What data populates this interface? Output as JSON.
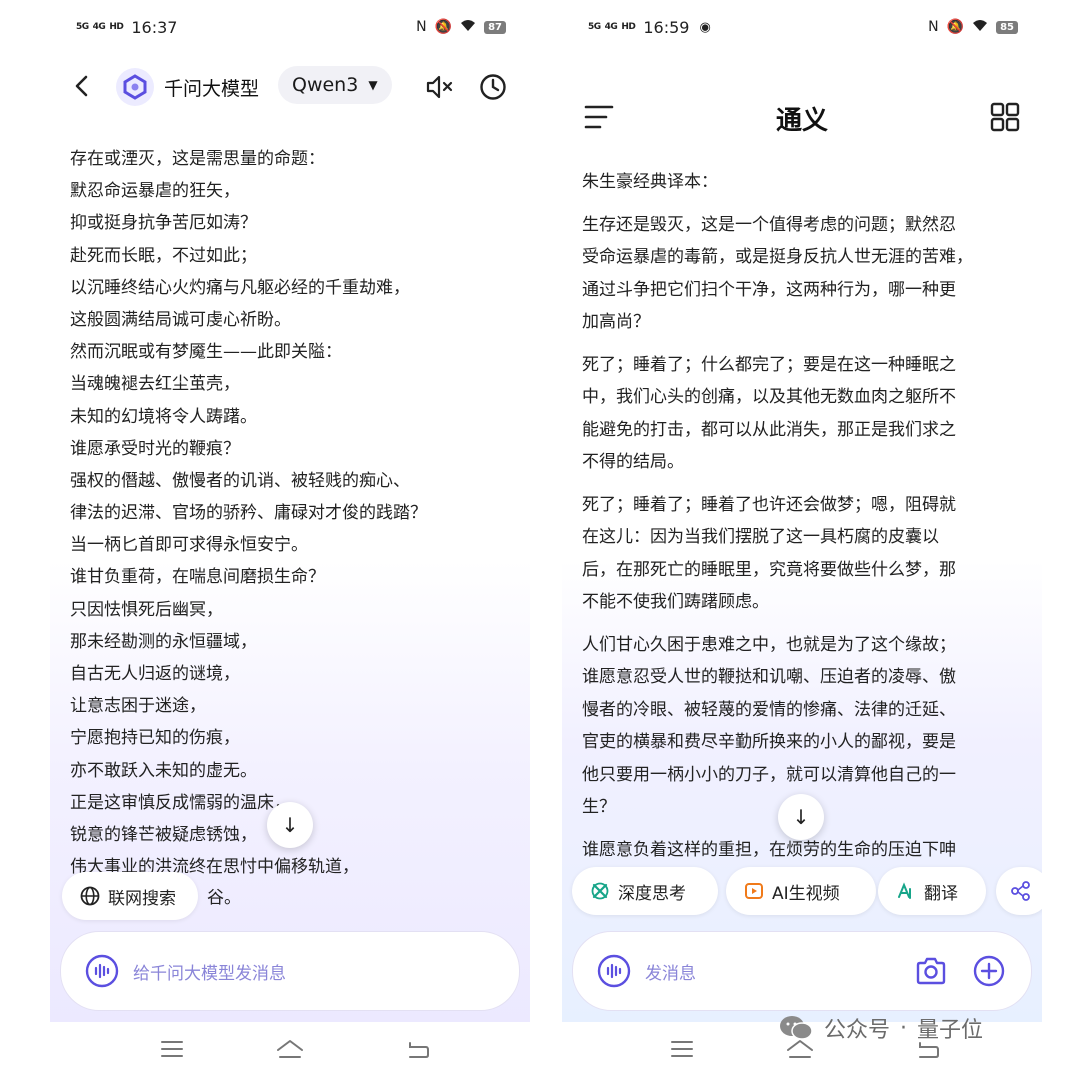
{
  "left": {
    "status": {
      "sig1": "5G",
      "sig2": "4G",
      "hd": "HD",
      "time": "16:37",
      "battery": "87"
    },
    "header": {
      "title": "千问大模型",
      "model": "Qwen3"
    },
    "poem": [
      "存在或湮灭，这是需思量的命题：",
      "默忍命运暴虐的狂矢，",
      "抑或挺身抗争苦厄如涛？",
      "赴死而长眠，不过如此；",
      "以沉睡终结心火灼痛与凡躯必经的千重劫难，",
      "这般圆满结局诚可虔心祈盼。",
      "然而沉眠或有梦魇生——此即关隘：",
      "当魂魄褪去红尘茧壳，",
      "未知的幻境将令人踌躇。",
      "谁愿承受时光的鞭痕？",
      "强权的僭越、傲慢者的讥诮、被轻贱的痴心、",
      "律法的迟滞、官场的骄矜、庸碌对才俊的践踏？",
      "当一柄匕首即可求得永恒安宁。",
      "谁甘负重荷，在喘息间磨损生命？",
      "只因怯惧死后幽冥，",
      "那未经勘测的永恒疆域，",
      "自古无人归返的谜境，",
      "让意志困于迷途，",
      "宁愿抱持已知的伤痕，",
      "亦不敢跃入未知的虚无。",
      "正是这审慎反成懦弱的温床，",
      "锐意的锋芒被疑虑锈蚀，",
      "伟大事业的洪流终在思忖中偏移轨道，"
    ],
    "last_line_visible": "谷。",
    "chip_label": "联网搜索",
    "input_placeholder": "给千问大模型发消息"
  },
  "right": {
    "status": {
      "sig1": "5G",
      "sig2": "4G",
      "hd": "HD",
      "time": "16:59",
      "battery": "85"
    },
    "header": {
      "title": "通义"
    },
    "intro": "朱生豪经典译本：",
    "paragraphs": [
      [
        "生存还是毁灭，这是一个值得考虑的问题；默然忍",
        "受命运暴虐的毒箭，或是挺身反抗人世无涯的苦难，",
        "通过斗争把它们扫个干净，这两种行为，哪一种更",
        "加高尚？"
      ],
      [
        "死了；睡着了；什么都完了；要是在这一种睡眠之",
        "中，我们心头的创痛，以及其他无数血肉之躯所不",
        "能避免的打击，都可以从此消失，那正是我们求之",
        "不得的结局。"
      ],
      [
        "死了；睡着了；睡着了也许还会做梦；嗯，阻碍就",
        "在这儿：因为当我们摆脱了这一具朽腐的皮囊以",
        "后，在那死亡的睡眠里，究竟将要做些什么梦，那",
        "不能不使我们踌躇顾虑。"
      ],
      [
        "人们甘心久困于患难之中，也就是为了这个缘故；",
        "谁愿意忍受人世的鞭挞和讥嘲、压迫者的凌辱、傲",
        "慢者的冷眼、被轻蔑的爱情的惨痛、法律的迁延、",
        "官吏的横暴和费尽辛勤所换来的小人的鄙视，要是",
        "他只要用一柄小小的刀子，就可以清算他自己的一",
        "生？"
      ],
      [
        "谁愿意负着这样的重担，在烦劳的生命的压迫下呻"
      ]
    ],
    "chips": [
      "深度思考",
      "AI生视频",
      "翻译"
    ],
    "input_placeholder": "发消息"
  },
  "watermark": {
    "prefix": "公众号",
    "name": "量子位"
  },
  "colors": {
    "accent": "#5b4fe0",
    "chip_icon_green": "#17a589",
    "chip_icon_orange": "#f07a1a"
  }
}
